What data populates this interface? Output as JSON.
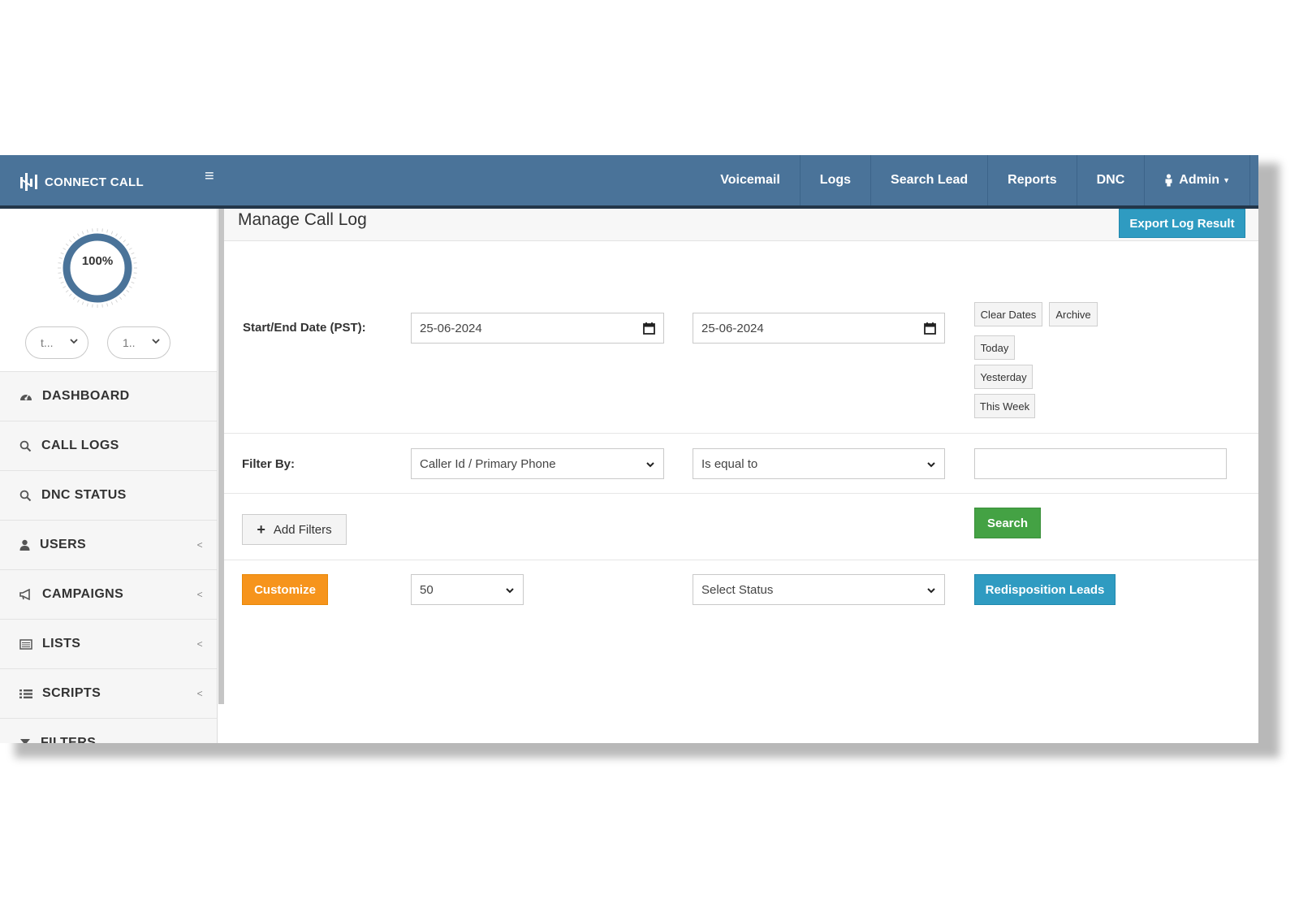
{
  "app": {
    "name": "CONNECT CALL"
  },
  "navbar": {
    "items": [
      "Voicemail",
      "Logs",
      "Search Lead",
      "Reports",
      "DNC"
    ],
    "user_menu": "Admin"
  },
  "sidebar": {
    "progress_label": "100%",
    "progress": 1.0,
    "selects": [
      "t...",
      "1.."
    ],
    "menu": [
      {
        "label": "DASHBOARD",
        "icon": "dashboard-icon"
      },
      {
        "label": "CALL LOGS",
        "icon": "search-icon"
      },
      {
        "label": "DNC STATUS",
        "icon": "search-icon"
      },
      {
        "label": "USERS",
        "icon": "user-icon",
        "expandable": true
      },
      {
        "label": "CAMPAIGNS",
        "icon": "bullhorn-icon",
        "expandable": true
      },
      {
        "label": "LISTS",
        "icon": "list-alt-icon",
        "expandable": true
      },
      {
        "label": "SCRIPTS",
        "icon": "list-icon",
        "expandable": true
      },
      {
        "label": "FILTERS",
        "icon": "filter-icon"
      }
    ]
  },
  "main": {
    "title": "Manage Call Log",
    "export_button": "Export Log Result",
    "date_label": "Start/End Date (PST):",
    "start_date": "25-06-2024",
    "end_date": "25-06-2024",
    "date_buttons": {
      "clear": "Clear Dates",
      "archive": "Archive",
      "today": "Today",
      "yesterday": "Yesterday",
      "this_week": "This Week"
    },
    "filter_label": "Filter By:",
    "filter_field": "Caller Id / Primary Phone",
    "filter_operator": "Is equal to",
    "filter_value": "",
    "add_filters": "Add Filters",
    "search_button": "Search",
    "customize_button": "Customize",
    "page_size": "50",
    "status_select": "Select Status",
    "redisposition_button": "Redisposition Leads"
  },
  "colors": {
    "navbar": "#4a7399",
    "accent_blue": "#2f9bc1",
    "search_green": "#44a244",
    "customize_orange": "#f6941c"
  }
}
